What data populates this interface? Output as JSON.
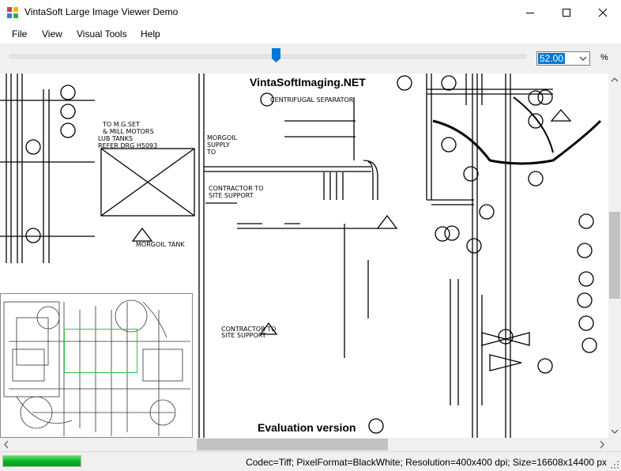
{
  "window": {
    "title": "VintaSoft Large Image Viewer Demo",
    "icons": {
      "app": "app-icon",
      "minimize": "minimize-icon",
      "maximize": "maximize-icon",
      "close": "close-icon"
    }
  },
  "menu": {
    "items": [
      "File",
      "View",
      "Visual Tools",
      "Help"
    ]
  },
  "toolbar": {
    "zoom_value": "52.00",
    "zoom_unit": "%"
  },
  "viewer": {
    "watermark_top": "VintaSoftImaging.NET",
    "watermark_bottom": "Evaluation version"
  },
  "status": {
    "progress": 1.0,
    "info": "Codec=Tiff; PixelFormat=BlackWhite; Resolution=400x400 dpi; Size=16608x14400 px"
  },
  "colors": {
    "progress": "#06b025",
    "selection": "#0078d7",
    "thumbnail_frame": "#33c24d"
  }
}
